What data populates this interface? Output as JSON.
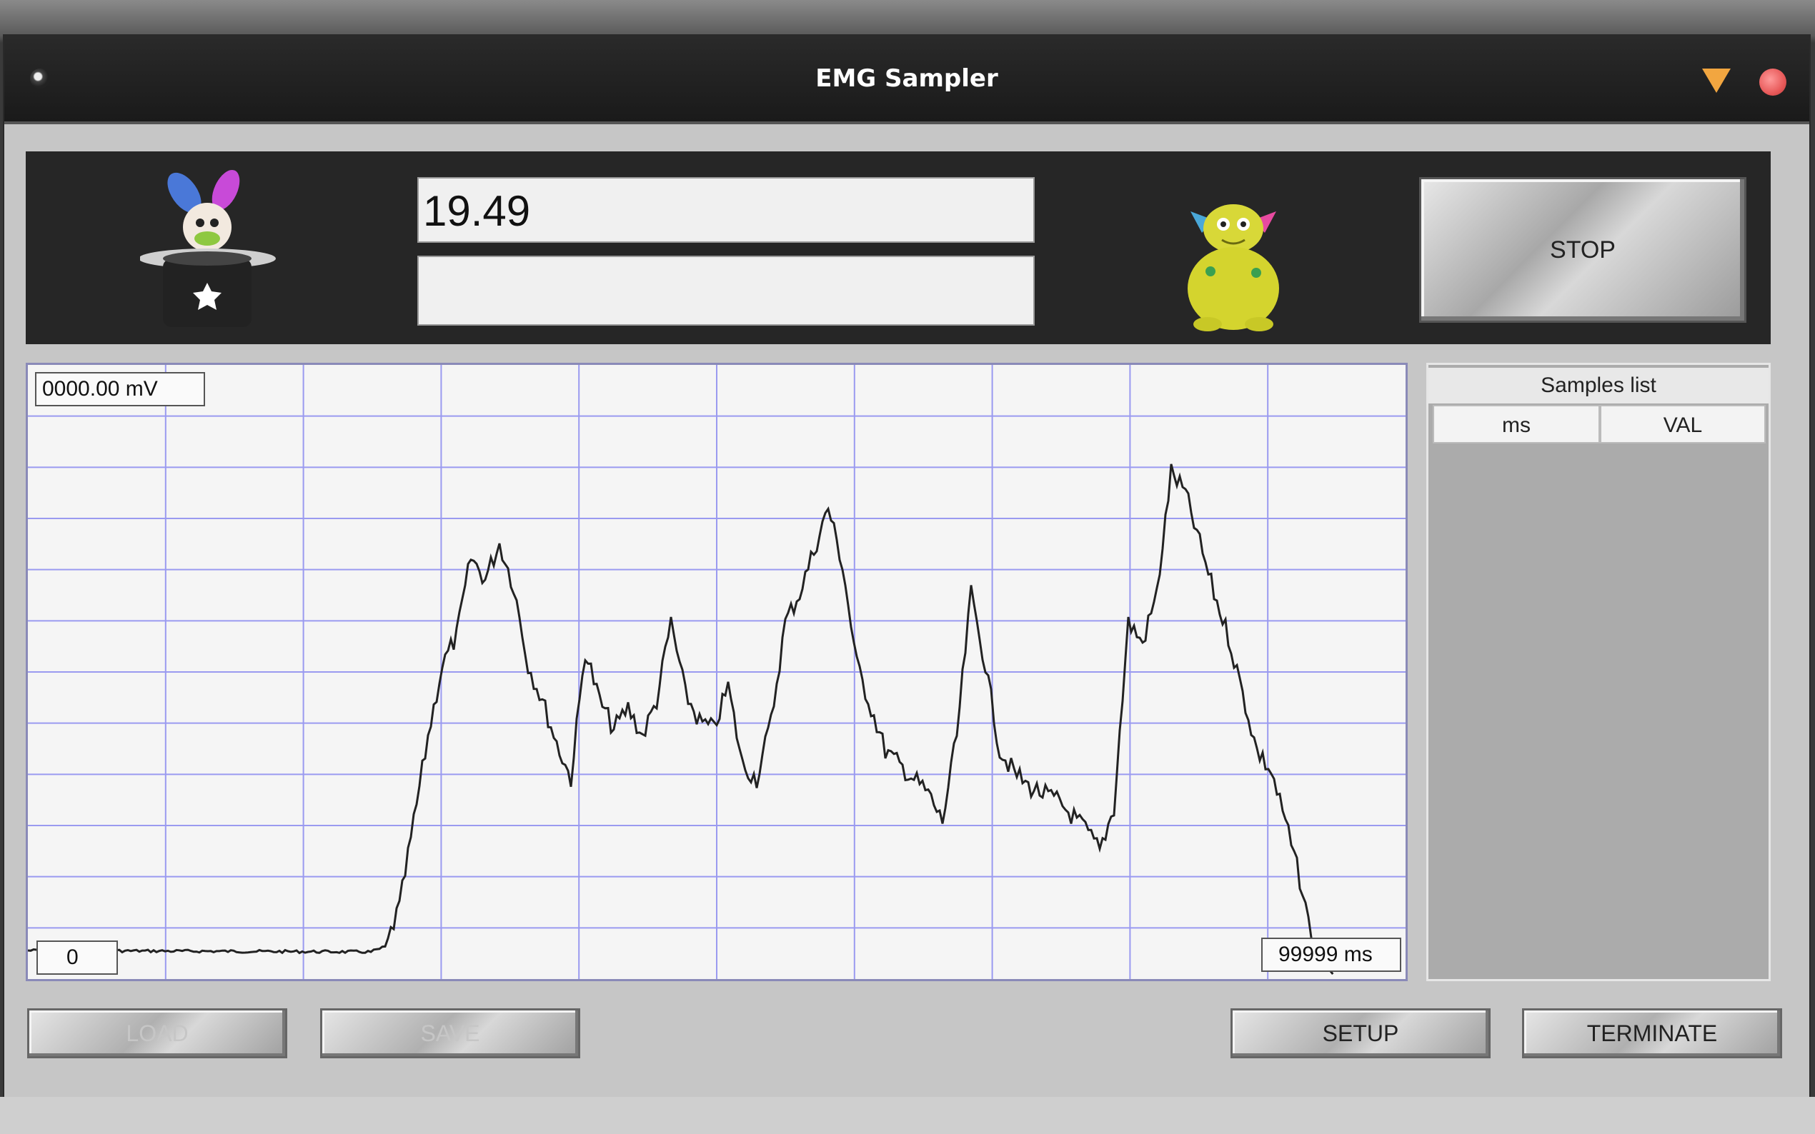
{
  "window": {
    "title": "EMG Sampler"
  },
  "display": {
    "value": "19.49",
    "secondary": ""
  },
  "buttons": {
    "stop": "STOP",
    "load": "LOAD",
    "save": "SAVE",
    "setup": "SETUP",
    "terminate": "TERMINATE"
  },
  "plot": {
    "y_readout": "0000.00 mV",
    "x_start": "0",
    "x_end": "99999 ms"
  },
  "samples_list": {
    "title": "Samples list",
    "columns": [
      "ms",
      "VAL"
    ]
  },
  "icons": {
    "left_mascot": "rabbit-in-hat-icon",
    "right_mascot": "green-monster-icon",
    "window_menu": "window-menu-dot-icon",
    "minimize": "minimize-triangle-icon",
    "close": "close-circle-icon"
  },
  "colors": {
    "grid": "#9a9af0",
    "trace": "#222222",
    "stop_accent": "#bbbbbb",
    "close": "#e85a5a",
    "minimize": "#f2a640"
  }
}
